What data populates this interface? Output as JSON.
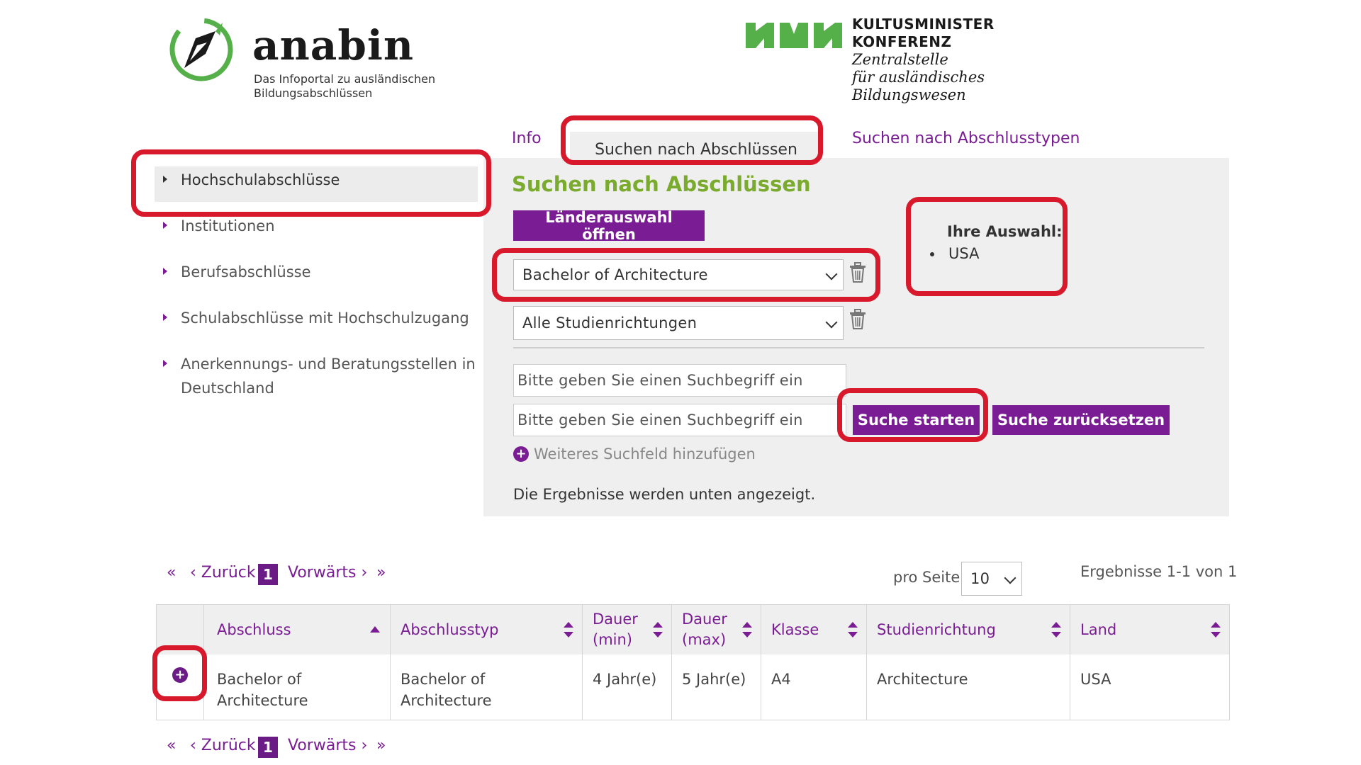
{
  "header": {
    "anabin_name": "anabin",
    "anabin_sub_line1": "Das Infoportal zu ausländischen",
    "anabin_sub_line2": "Bildungsabschlüssen",
    "kmk_line1": "KULTUSMINISTER",
    "kmk_line2": "KONFERENZ",
    "kmk_line3": "Zentralstelle",
    "kmk_line4": "für ausländisches",
    "kmk_line5": "Bildungswesen"
  },
  "tabs": [
    {
      "label": "Info"
    },
    {
      "label": "Suchen nach Abschlüssen"
    },
    {
      "label": "Suchen nach Abschlusstypen"
    }
  ],
  "sidebar": {
    "items": [
      {
        "label": "Hochschulabschlüsse"
      },
      {
        "label": "Institutionen"
      },
      {
        "label": "Berufsabschlüsse"
      },
      {
        "label": "Schulabschlüsse mit Hochschulzugang"
      },
      {
        "label_line1": "Anerkennungs- und Beratungsstellen in",
        "label_line2": "Deutschland"
      }
    ]
  },
  "main": {
    "title": "Suchen nach Abschlüssen",
    "country_button": "Länderauswahl öffnen",
    "selection_title": "Ihre Auswahl:",
    "selection_items": [
      "USA"
    ],
    "degree_select": "Bachelor of Architecture",
    "field_select": "Alle Studienrichtungen",
    "search_placeholder": "Bitte geben Sie einen Suchbegriff ein",
    "search_button": "Suche starten",
    "reset_button": "Suche zurücksetzen",
    "add_field": "Weiteres Suchfeld hinzufügen",
    "results_note": "Die Ergebnisse werden unten angezeigt."
  },
  "pagination": {
    "first": "«",
    "prev": "‹ Zurück",
    "current": "1",
    "next": "Vorwärts ›",
    "last": "»",
    "per_page_label": "pro Seite",
    "per_page_value": "10",
    "results_summary": "Ergebnisse 1-1 von 1"
  },
  "table": {
    "columns": [
      {
        "line1": "Abschluss",
        "line2": ""
      },
      {
        "line1": "Abschlusstyp",
        "line2": ""
      },
      {
        "line1": "Dauer",
        "line2": "(min)"
      },
      {
        "line1": "Dauer",
        "line2": "(max)"
      },
      {
        "line1": "Klasse",
        "line2": ""
      },
      {
        "line1": "Studienrichtung",
        "line2": ""
      },
      {
        "line1": "Land",
        "line2": ""
      }
    ],
    "rows": [
      {
        "abschluss_line1": "Bachelor of",
        "abschluss_line2": "Architecture",
        "typ_line1": "Bachelor of",
        "typ_line2": "Architecture",
        "dauer_min": "4 Jahr(e)",
        "dauer_max": "5 Jahr(e)",
        "klasse": "A4",
        "studienrichtung": "Architecture",
        "land": "USA"
      }
    ]
  },
  "colors": {
    "purple": "#7a1c94",
    "green": "#7aab2f",
    "highlight": "#d8182b"
  }
}
